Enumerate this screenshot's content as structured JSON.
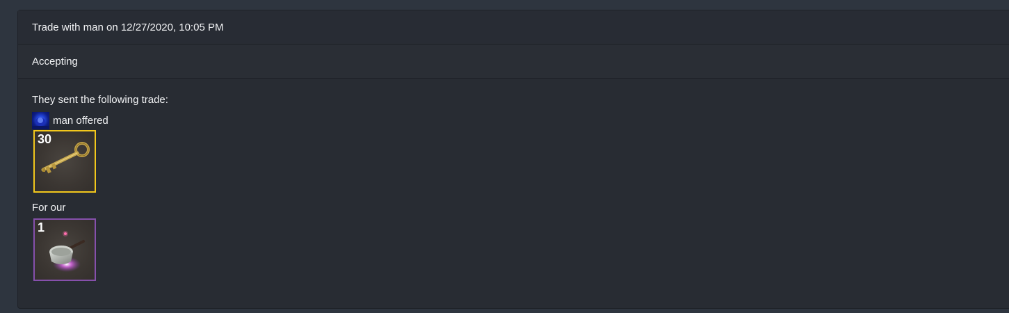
{
  "trade": {
    "title": "Trade with man on 12/27/2020, 10:05 PM",
    "status": "Accepting",
    "intro": "They sent the following trade:",
    "offered_label": "man offered",
    "for_label": "For our"
  },
  "their_items": [
    {
      "quantity": "30",
      "icon": "key-icon",
      "border_color": "#f3c81c"
    }
  ],
  "our_items": [
    {
      "quantity": "1",
      "icon": "frying-pan-icon",
      "border_color": "#8650ac"
    }
  ],
  "colors": {
    "page_bg": "#2e353f",
    "card_bg": "#282c33",
    "unique_border": "#f3c81c",
    "unusual_border": "#8650ac"
  }
}
